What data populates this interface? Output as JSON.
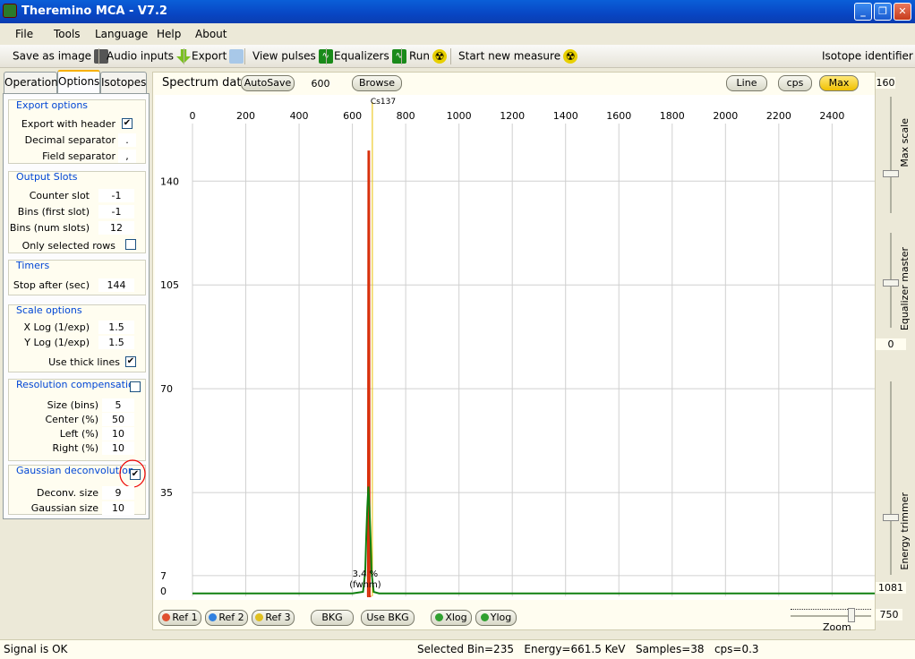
{
  "window": {
    "title": "Theremino MCA - V7.2",
    "min": "_",
    "max": "❐",
    "close": "✕"
  },
  "menu": [
    "File",
    "Tools",
    "Language",
    "Help",
    "About"
  ],
  "toolbar": {
    "save_image": "Save as image",
    "audio_inputs": "Audio inputs",
    "export": "Export",
    "view_pulses": "View pulses",
    "equalizers": "Equalizers",
    "run": "Run",
    "start_new_measure": "Start new measure",
    "isotope_identifier": "Isotope identifier"
  },
  "tabs": [
    "Operation",
    "Options",
    "Isotopes"
  ],
  "export_options": {
    "title": "Export options",
    "header_label": "Export with header",
    "decimal_label": "Decimal separator",
    "decimal_value": ".",
    "field_label": "Field separator",
    "field_value": ","
  },
  "output_slots": {
    "title": "Output Slots",
    "counter_label": "Counter slot",
    "counter_value": "-1",
    "bins_first_label": "Bins (first slot)",
    "bins_first_value": "-1",
    "bins_num_label": "Bins (num slots)",
    "bins_num_value": "12",
    "only_selected_label": "Only selected rows"
  },
  "timers": {
    "title": "Timers",
    "stop_label": "Stop after (sec)",
    "stop_value": "144"
  },
  "scale_options": {
    "title": "Scale options",
    "xlog_label": "X Log (1/exp)",
    "xlog_value": "1.5",
    "ylog_label": "Y Log (1/exp)",
    "ylog_value": "1.5",
    "thick_label": "Use thick lines"
  },
  "resolution": {
    "title": "Resolution compensation",
    "size_label": "Size (bins)",
    "size_value": "5",
    "center_label": "Center (%)",
    "center_value": "50",
    "left_label": "Left (%)",
    "left_value": "10",
    "right_label": "Right (%)",
    "right_value": "10"
  },
  "gaussian": {
    "title": "Gaussian deconvolution",
    "deconv_label": "Deconv. size",
    "deconv_value": "9",
    "gauss_label": "Gaussian size",
    "gauss_value": "10"
  },
  "spectrum": {
    "label": "Spectrum data",
    "autosave": "AutoSave",
    "autosave_value": "600",
    "browse": "Browse",
    "line": "Line",
    "cps": "cps",
    "max": "Max",
    "max_value": "160"
  },
  "bottom_buttons": {
    "ref1": "Ref 1",
    "ref2": "Ref 2",
    "ref3": "Ref 3",
    "bkg": "BKG",
    "use_bkg": "Use BKG",
    "xlog": "Xlog",
    "ylog": "Ylog"
  },
  "right_panel": {
    "max_scale": "Max scale",
    "equalizer_master": "Equalizer master",
    "eq_value": "0",
    "energy_trimmer": "Energy trimmer",
    "energy_value": "1081",
    "zoom_label": "Zoom",
    "zoom_value": "750"
  },
  "chart_data": {
    "type": "line",
    "x_ticks": [
      0,
      200,
      400,
      600,
      800,
      1000,
      1200,
      1400,
      1600,
      1800,
      2000,
      2200,
      2400
    ],
    "xlim": [
      0,
      2560
    ],
    "y_ticks": [
      0,
      7,
      35,
      70,
      105,
      140
    ],
    "ylim": [
      0,
      160
    ],
    "peak_label": "Cs137",
    "peak_energy": 661.5,
    "fwhm_label": "3.4 %",
    "fwhm_sub": "(fwhm)",
    "series": [
      {
        "color": "#d8300c",
        "points": [
          [
            655,
            0
          ],
          [
            658,
            0
          ],
          [
            660,
            150
          ],
          [
            663,
            150
          ],
          [
            665,
            0
          ],
          [
            670,
            0
          ]
        ]
      },
      {
        "color": "#108010",
        "points": [
          [
            0,
            1
          ],
          [
            600,
            1
          ],
          [
            640,
            1.5
          ],
          [
            648,
            8
          ],
          [
            652,
            20
          ],
          [
            656,
            30
          ],
          [
            660,
            37
          ],
          [
            664,
            30
          ],
          [
            668,
            20
          ],
          [
            672,
            8
          ],
          [
            680,
            1.5
          ],
          [
            700,
            1
          ],
          [
            2560,
            1
          ]
        ]
      }
    ],
    "grid": true
  },
  "status": {
    "signal": "Signal is OK",
    "info": "Selected Bin=235   Energy=661.5 KeV   Samples=38   cps=0.3"
  }
}
